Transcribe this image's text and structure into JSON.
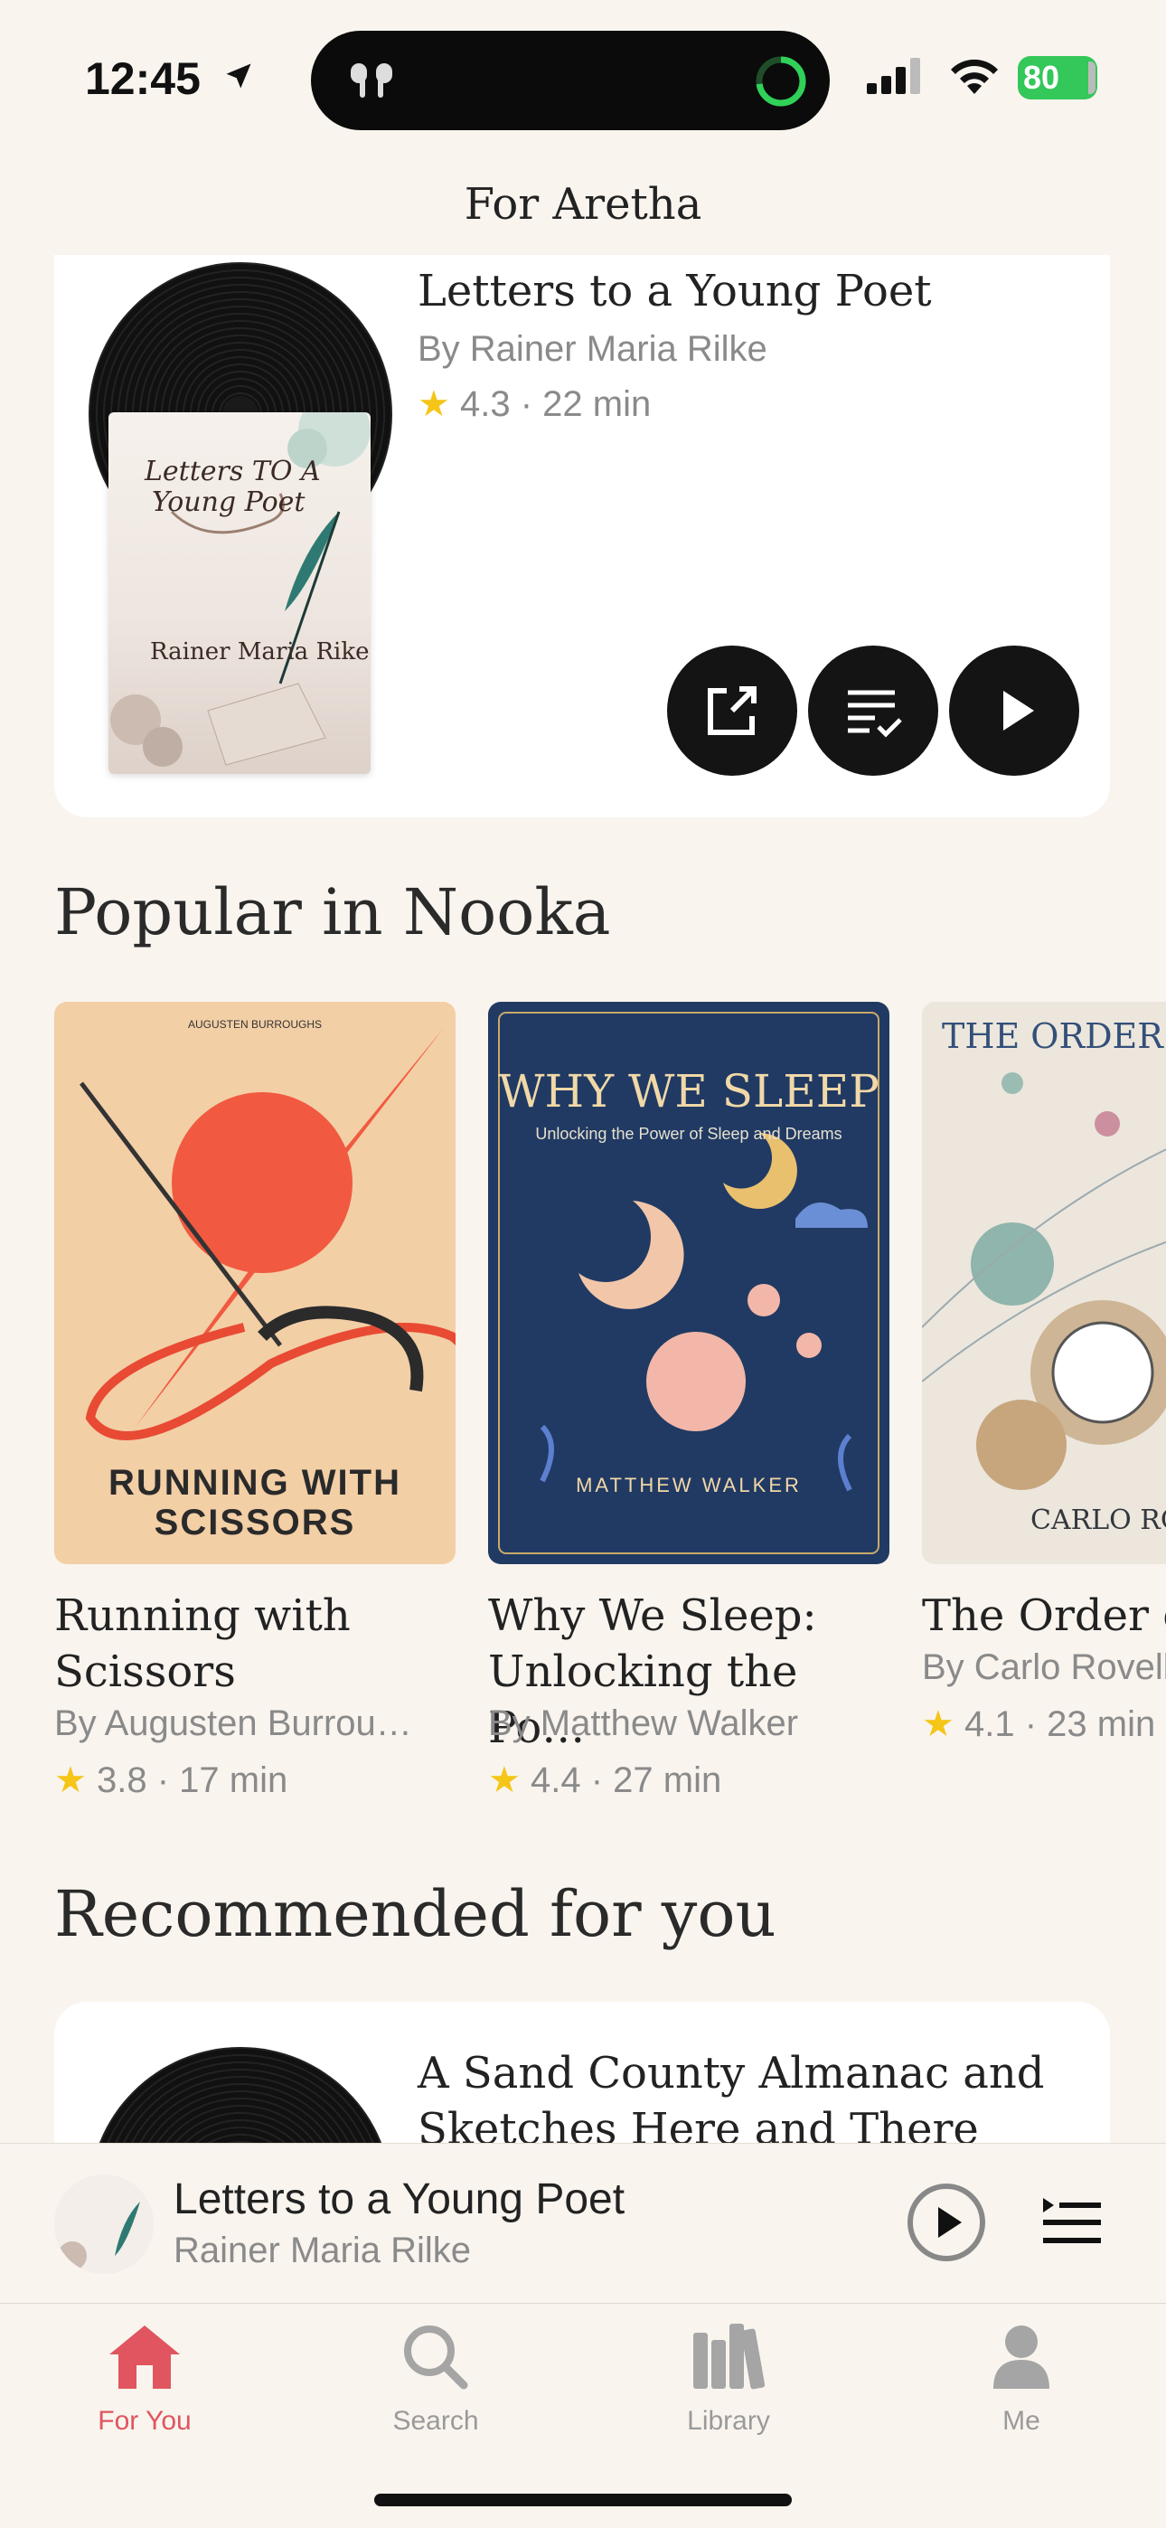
{
  "status_bar": {
    "time": "12:45",
    "battery": "80"
  },
  "header": {
    "title": "For Aretha"
  },
  "hero": {
    "title": "Letters to a Young Poet",
    "author": "By Rainer Maria Rilke",
    "rating": "4.3",
    "duration": "22 min",
    "cover_title_line1": "Letters TO A",
    "cover_title_line2": "Young Poet",
    "cover_author": "Rainer Maria Rike"
  },
  "popular": {
    "title": "Popular in Nooka",
    "books": [
      {
        "title": "Running with Scissors",
        "author": "By Augusten Burrou…",
        "rating": "3.8",
        "duration": "17 min",
        "cover_author": "AUGUSTEN BURROUGHS",
        "cover_title": "RUNNING WITH SCISSORS"
      },
      {
        "title": "Why We Sleep: Unlocking the Po…",
        "author": "By Matthew Walker",
        "rating": "4.4",
        "duration": "27 min",
        "cover_title": "WHY WE SLEEP",
        "cover_subtitle": "Unlocking the Power of Sleep and Dreams",
        "cover_author": "MATTHEW WALKER"
      },
      {
        "title": "The Order of Time",
        "author": "By Carlo Rovelli",
        "rating": "4.1",
        "duration": "23 min",
        "cover_title": "THE ORDER OF TIME",
        "cover_author": "CARLO ROVELLI"
      }
    ]
  },
  "recommended": {
    "title": "Recommended for you",
    "book_title": "A Sand County Almanac and Sketches Here and There"
  },
  "mini_player": {
    "title": "Letters to a Young Poet",
    "author": "Rainer Maria Rilke"
  },
  "tabs": [
    {
      "label": "For You",
      "icon": "home-icon"
    },
    {
      "label": "Search",
      "icon": "search-icon"
    },
    {
      "label": "Library",
      "icon": "library-icon"
    },
    {
      "label": "Me",
      "icon": "person-icon"
    }
  ],
  "colors": {
    "accent": "#e0555f",
    "star": "#f5c518",
    "background": "#f9f4ee"
  }
}
